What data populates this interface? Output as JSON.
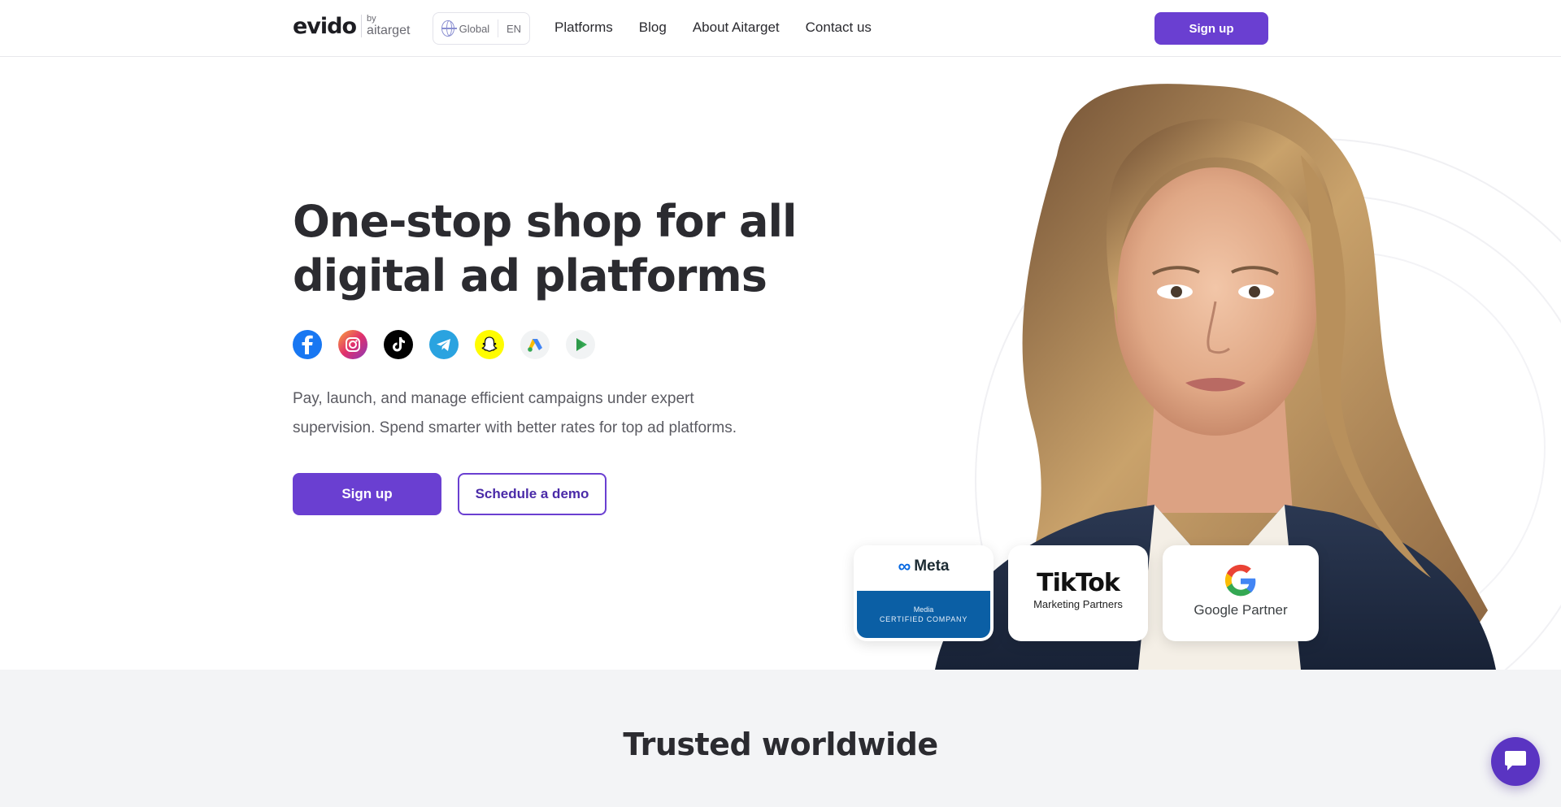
{
  "header": {
    "logo_main": "evido",
    "logo_by": "by",
    "logo_brand": "aitarget",
    "region_label": "Global",
    "language": "EN",
    "nav": [
      {
        "label": "Platforms"
      },
      {
        "label": "Blog"
      },
      {
        "label": "About Aitarget"
      },
      {
        "label": "Contact us"
      }
    ],
    "signup_label": "Sign up"
  },
  "hero": {
    "title": "One-stop shop for all digital ad platforms",
    "platform_icons": [
      "facebook-icon",
      "instagram-icon",
      "tiktok-icon",
      "telegram-icon",
      "snapchat-icon",
      "google-ads-icon",
      "google-play-icon"
    ],
    "description": "Pay, launch, and manage efficient campaigns under expert supervision. Spend smarter with better rates for top ad platforms.",
    "primary_cta": "Sign up",
    "secondary_cta": "Schedule a demo",
    "badges": {
      "meta": {
        "brand": "Meta",
        "line1": "Media",
        "line2": "CERTIFIED COMPANY"
      },
      "tiktok": {
        "brand": "TikTok",
        "sub": "Marketing Partners"
      },
      "google": {
        "label": "Google Partner"
      }
    }
  },
  "trusted": {
    "title": "Trusted worldwide"
  },
  "colors": {
    "accent": "#6a3fd1",
    "text": "#2b2b30",
    "muted": "#5b5b62",
    "section_bg": "#f3f4f6"
  }
}
